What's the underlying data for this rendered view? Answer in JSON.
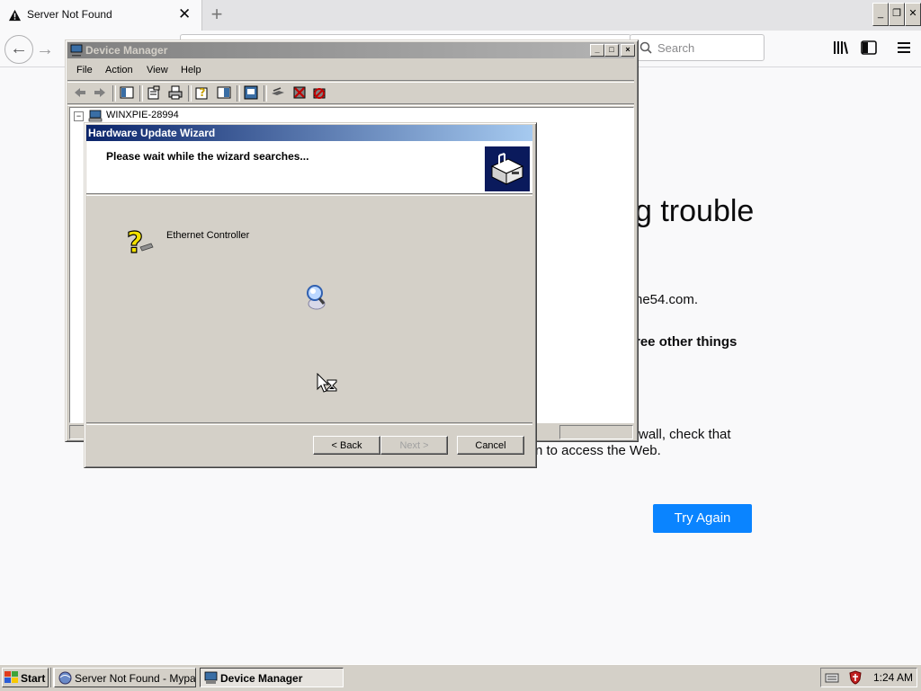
{
  "browser": {
    "tab_title": "Server Not Found",
    "tab_close": "✕",
    "new_tab": "+",
    "search_placeholder": "Search",
    "window_buttons": [
      "_",
      "❐",
      "✕"
    ]
  },
  "error_page": {
    "title_fragment": "g trouble",
    "host_fragment": "ne54.com.",
    "subheading_fragment": "ree other things",
    "line1_fragment": "wall, check that",
    "line2_fragment": "n to access the Web.",
    "try_again": "Try Again",
    "accent_color": "#0a84ff"
  },
  "device_manager": {
    "title": "Device Manager",
    "menu": [
      "File",
      "Action",
      "View",
      "Help"
    ],
    "tree_root": "WINXPIE-28994",
    "tree_expander": "−"
  },
  "wizard": {
    "title": "Hardware Update Wizard",
    "header_text": "Please wait while the wizard searches...",
    "device_name": "Ethernet Controller",
    "buttons": {
      "back": "< Back",
      "next": "Next >",
      "cancel": "Cancel"
    }
  },
  "taskbar": {
    "start": "Start",
    "tasks": [
      "Server Not Found - Mypal",
      "Device Manager"
    ],
    "clock": "1:24 AM"
  }
}
